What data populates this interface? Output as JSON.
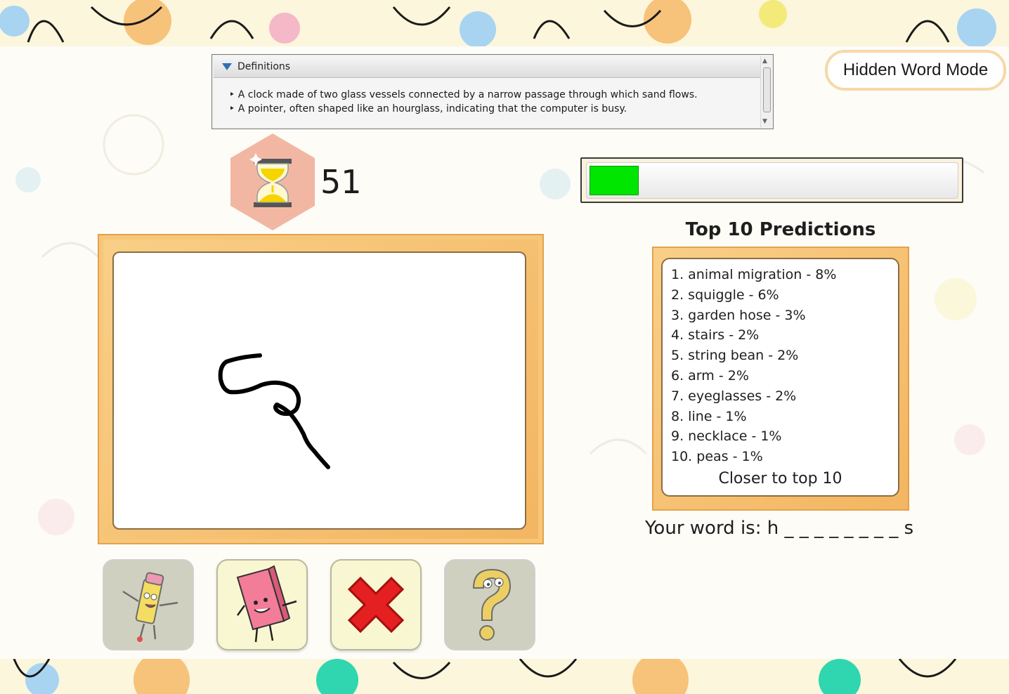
{
  "definitions": {
    "header": "Definitions",
    "lines": [
      "A clock made of two glass vessels connected by a narrow passage through which sand flows.",
      "A pointer, often shaped like an hourglass, indicating that the computer is busy."
    ]
  },
  "mode_label": "Hidden Word Mode",
  "timer": {
    "icon": "hourglass-icon",
    "seconds": "51"
  },
  "progress": {
    "fraction": 0.135,
    "color": "#00e600"
  },
  "predictions": {
    "title": "Top 10 Predictions",
    "items": [
      "1. animal migration - 8%",
      "2. squiggle - 6%",
      "3. garden hose - 3%",
      "4. stairs - 2%",
      "5. string bean - 2%",
      "6. arm - 2%",
      "7. eyeglasses - 2%",
      "8. line - 1%",
      "9. necklace - 1%",
      "10. peas - 1%"
    ],
    "footer": "Closer to top 10"
  },
  "word_hint": "Your word is: h _ _ _ _ _ _ _ _ s",
  "tools": [
    {
      "name": "pencil-tool",
      "icon": "pencil-character-icon",
      "enabled": false
    },
    {
      "name": "eraser-tool",
      "icon": "eraser-character-icon",
      "enabled": true
    },
    {
      "name": "clear-tool",
      "icon": "red-x-icon",
      "enabled": true
    },
    {
      "name": "hint-tool",
      "icon": "question-mark-character-icon",
      "enabled": false
    }
  ],
  "colors": {
    "accent": "#f3b561",
    "timer_hex": "#f2b7a3",
    "hourglass_sand": "#f5d400"
  }
}
